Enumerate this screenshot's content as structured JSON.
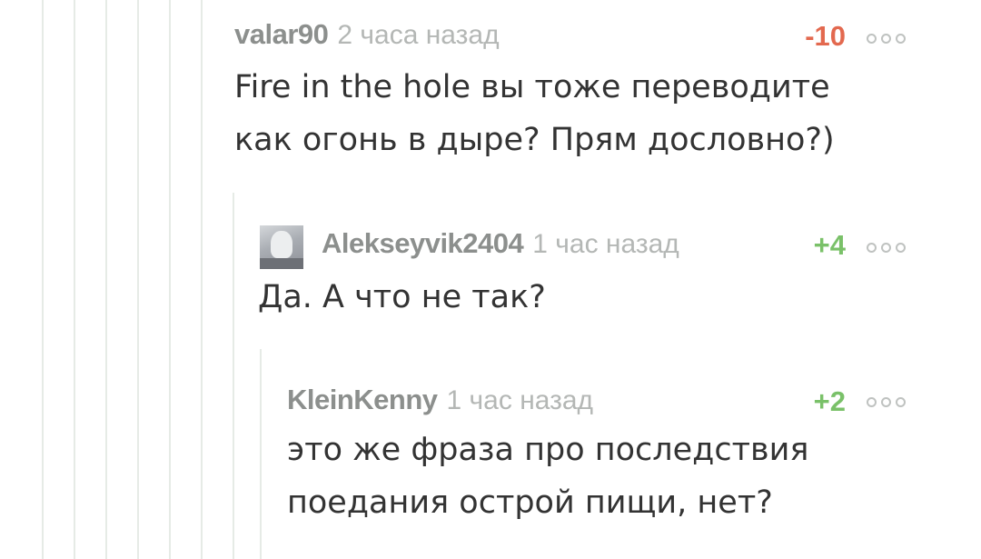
{
  "colors": {
    "author": "#8c8f8d",
    "time": "#b4b7b5",
    "body_text": "#333333",
    "rating_negative": "#e3694f",
    "rating_positive": "#7ac169",
    "thread_line": "#e6ebe6"
  },
  "comments": [
    {
      "author": "valar90",
      "time": "2 часа назад",
      "rating": "-10",
      "body_lines": [
        "Fire in the hole вы тоже переводите",
        "как огонь в дыре? Прям дословно?)"
      ],
      "more_icon": "more-options-icon"
    },
    {
      "author": "Alekseyvik2404",
      "time": "1 час назад",
      "rating": "+4",
      "body_lines": [
        "Да. А что не так?"
      ],
      "avatar": "user-avatar",
      "more_icon": "more-options-icon"
    },
    {
      "author": "KleinKenny",
      "time": "1 час назад",
      "rating": "+2",
      "body_lines": [
        "это же фраза про последствия",
        "поедания острой пищи, нет?"
      ],
      "more_icon": "more-options-icon"
    }
  ]
}
